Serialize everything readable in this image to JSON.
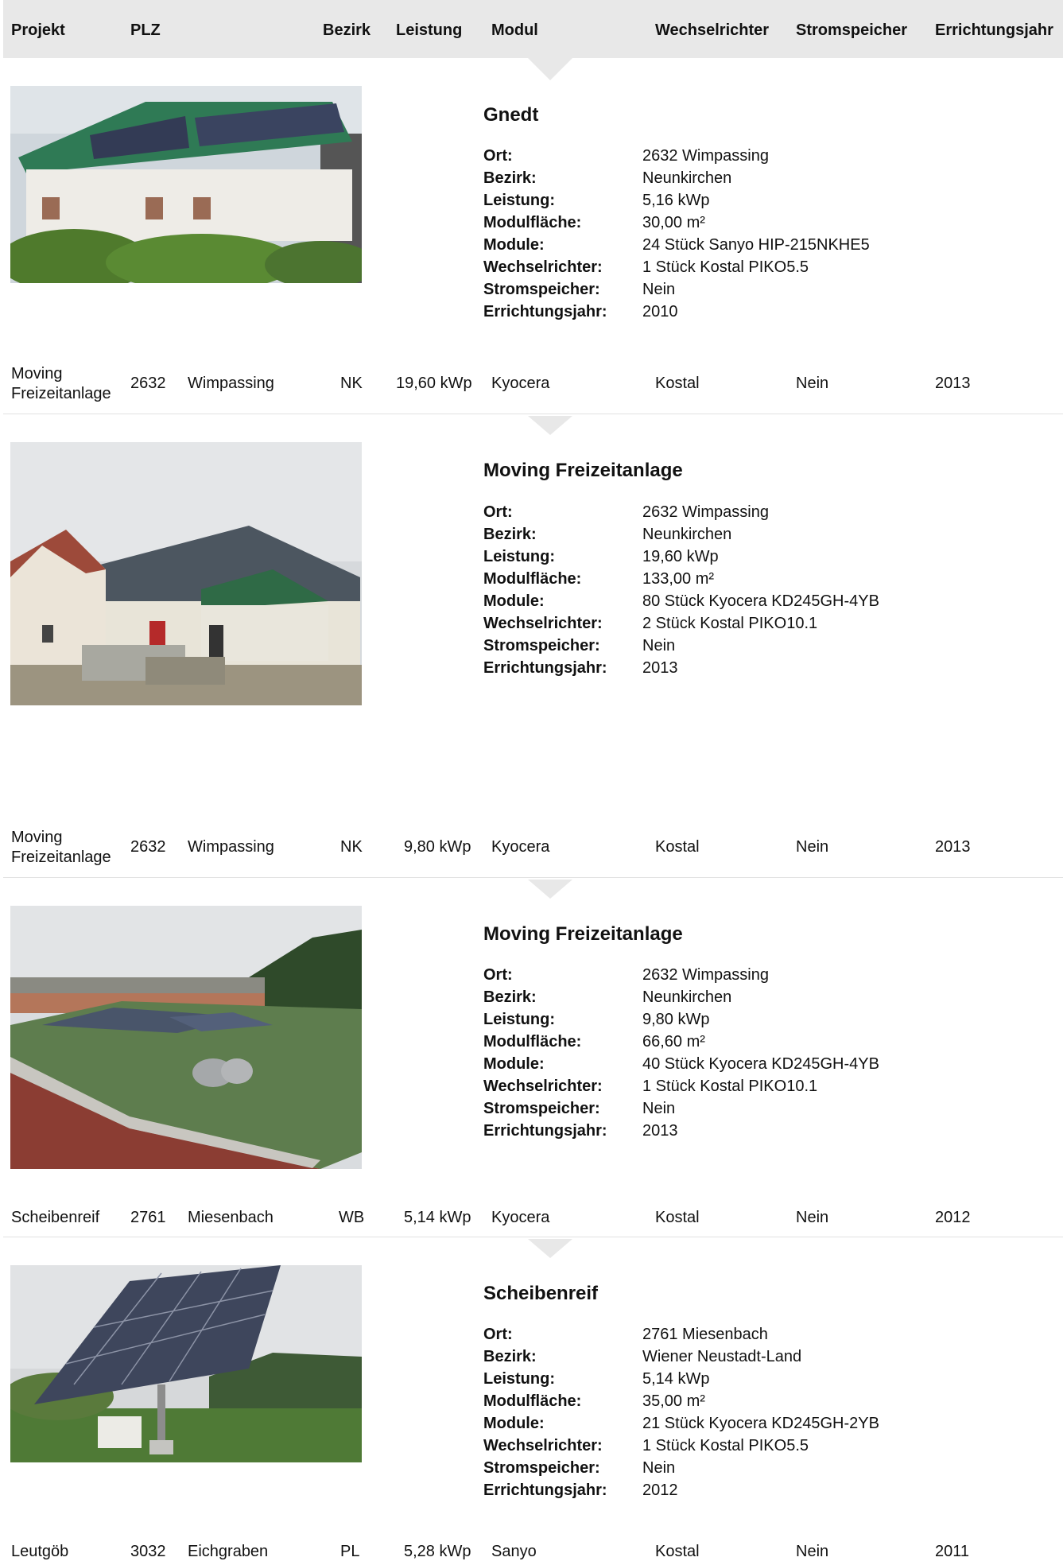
{
  "columns": [
    "Projekt",
    "PLZ",
    "Bezirk",
    "Leistung",
    "Modul",
    "Wechselrichter",
    "Stromspeicher",
    "Errichtungsjahr"
  ],
  "detail_labels": [
    "Ort:",
    "Bezirk:",
    "Leistung:",
    "Modulfläche:",
    "Module:",
    "Wechselrichter:",
    "Stromspeicher:",
    "Errichtungsjahr:"
  ],
  "details": [
    {
      "title": "Gnedt",
      "photo": "house-with-solar-roof",
      "values": [
        "2632 Wimpassing",
        "Neunkirchen",
        "5,16 kWp",
        "30,00 m²",
        "24 Stück Sanyo HIP-215NKHE5",
        "1 Stück Kostal PIKO5.5",
        "Nein",
        "2010"
      ]
    },
    {
      "title": "Moving Freizeitanlage",
      "photo": "hall-with-solar-roof",
      "values": [
        "2632 Wimpassing",
        "Neunkirchen",
        "19,60 kWp",
        "133,00 m²",
        "80 Stück Kyocera KD245GH-4YB",
        "2 Stück Kostal PIKO10.1",
        "Nein",
        "2013"
      ]
    },
    {
      "title": "Moving Freizeitanlage",
      "photo": "flat-green-roof-with-panels",
      "values": [
        "2632 Wimpassing",
        "Neunkirchen",
        "9,80 kWp",
        "66,60 m²",
        "40 Stück Kyocera KD245GH-4YB",
        "1 Stück Kostal PIKO10.1",
        "Nein",
        "2013"
      ]
    },
    {
      "title": "Scheibenreif",
      "photo": "solar-tracker-in-field",
      "values": [
        "2761 Miesenbach",
        "Wiener Neustadt-Land",
        "5,14 kWp",
        "35,00 m²",
        "21 Stück Kyocera KD245GH-2YB",
        "1 Stück Kostal PIKO5.5",
        "Nein",
        "2012"
      ]
    }
  ],
  "rows": [
    {
      "projekt_line1": "Moving",
      "projekt_line2": "Freizeitanlage",
      "plz": "2632",
      "ort": "Wimpassing",
      "bezirk": "NK",
      "leistung": "19,60 kWp",
      "modul": "Kyocera",
      "wechselrichter": "Kostal",
      "stromspeicher": "Nein",
      "jahr": "2013"
    },
    {
      "projekt_line1": "Moving",
      "projekt_line2": "Freizeitanlage",
      "plz": "2632",
      "ort": "Wimpassing",
      "bezirk": "NK",
      "leistung": "9,80 kWp",
      "modul": "Kyocera",
      "wechselrichter": "Kostal",
      "stromspeicher": "Nein",
      "jahr": "2013"
    },
    {
      "projekt_line1": "Scheibenreif",
      "projekt_line2": "",
      "plz": "2761",
      "ort": "Miesenbach",
      "bezirk": "WB",
      "leistung": "5,14 kWp",
      "modul": "Kyocera",
      "wechselrichter": "Kostal",
      "stromspeicher": "Nein",
      "jahr": "2012"
    },
    {
      "projekt_line1": "Leutgöb",
      "projekt_line2": "",
      "plz": "3032",
      "ort": "Eichgraben",
      "bezirk": "PL",
      "leistung": "5,28 kWp",
      "modul": "Sanyo",
      "wechselrichter": "Kostal",
      "stromspeicher": "Nein",
      "jahr": "2011"
    }
  ]
}
